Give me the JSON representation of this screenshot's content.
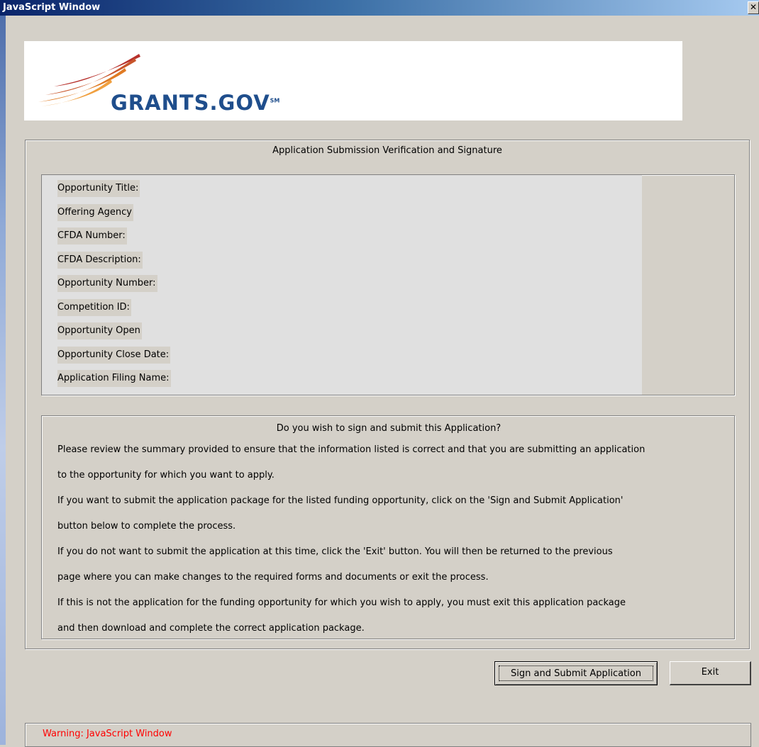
{
  "window": {
    "title": "JavaScript Window",
    "close_glyph": "✕"
  },
  "logo": {
    "text": "GRANTS.GOV",
    "mark": "SM"
  },
  "form": {
    "title": "Application Submission Verification and Signature",
    "fields": [
      {
        "label": "Opportunity Title:",
        "value": ""
      },
      {
        "label": "Offering Agency",
        "value": ""
      },
      {
        "label": "CFDA Number:",
        "value": ""
      },
      {
        "label": "CFDA Description:",
        "value": ""
      },
      {
        "label": "Opportunity Number: ",
        "value": ""
      },
      {
        "label": "Competition ID: ",
        "value": ""
      },
      {
        "label": "Opportunity Open",
        "value": ""
      },
      {
        "label": "Opportunity Close Date:",
        "value": ""
      },
      {
        "label": "Application Filing Name:",
        "value": ""
      }
    ]
  },
  "message": {
    "title": "Do you wish to sign and submit this Application?",
    "lines": [
      "Please review the summary provided to ensure that the information listed is correct and that you are submitting an application",
      "to the opportunity for which you want to apply.",
      "If you want to submit the application package for the listed funding opportunity, click on the 'Sign and Submit Application'",
      "button below to complete the process.",
      "If you do not want to submit the application at this time, click the 'Exit' button. You will then be returned to the previous",
      "page where you can make changes to the required forms and documents or exit the process.",
      "If this is not the application for the funding opportunity for which you wish to apply, you must exit this application package",
      "and then download and complete the correct application package."
    ]
  },
  "buttons": {
    "submit_label": "Sign and Submit Application",
    "exit_label": "Exit"
  },
  "warning": {
    "text": "Warning: JavaScript Window",
    "color": "#ff0000"
  }
}
